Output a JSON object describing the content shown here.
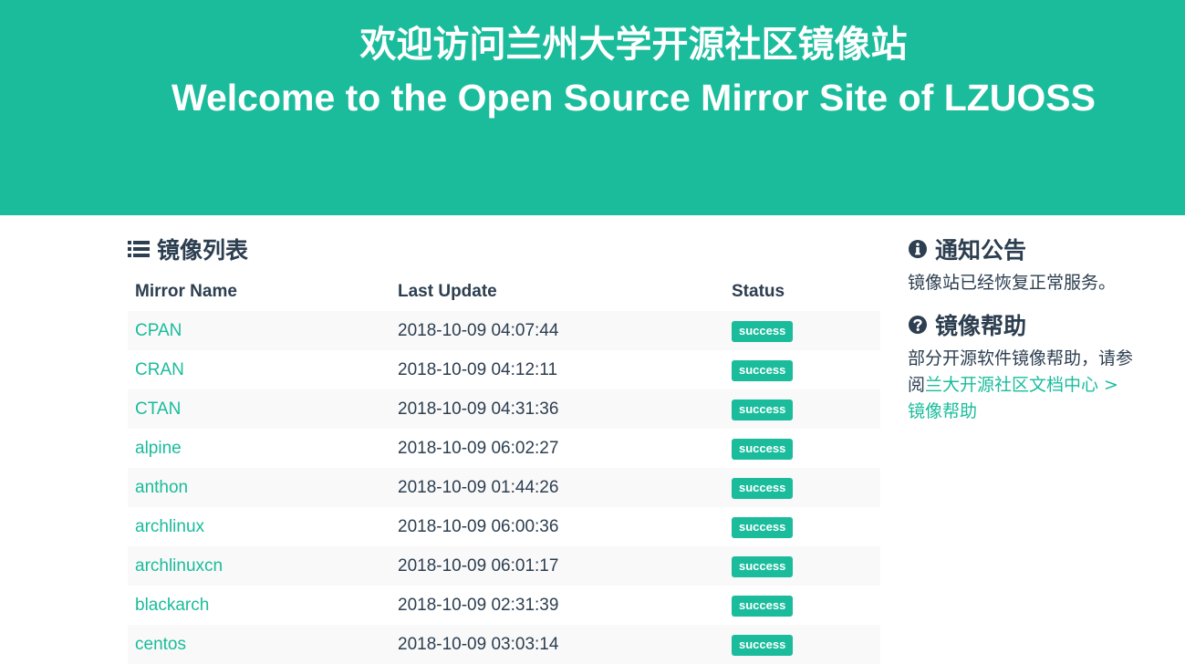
{
  "hero": {
    "title_cn": "欢迎访问兰州大学开源社区镜像站",
    "title_en": "Welcome to the Open Source Mirror Site of LZUOSS"
  },
  "mirror_list": {
    "heading": "镜像列表",
    "icon": "list-icon",
    "columns": {
      "name": "Mirror Name",
      "last_update": "Last Update",
      "status": "Status"
    },
    "rows": [
      {
        "name": "CPAN",
        "last_update": "2018-10-09 04:07:44",
        "status": "success"
      },
      {
        "name": "CRAN",
        "last_update": "2018-10-09 04:12:11",
        "status": "success"
      },
      {
        "name": "CTAN",
        "last_update": "2018-10-09 04:31:36",
        "status": "success"
      },
      {
        "name": "alpine",
        "last_update": "2018-10-09 06:02:27",
        "status": "success"
      },
      {
        "name": "anthon",
        "last_update": "2018-10-09 01:44:26",
        "status": "success"
      },
      {
        "name": "archlinux",
        "last_update": "2018-10-09 06:00:36",
        "status": "success"
      },
      {
        "name": "archlinuxcn",
        "last_update": "2018-10-09 06:01:17",
        "status": "success"
      },
      {
        "name": "blackarch",
        "last_update": "2018-10-09 02:31:39",
        "status": "success"
      },
      {
        "name": "centos",
        "last_update": "2018-10-09 03:03:14",
        "status": "success"
      }
    ]
  },
  "notice": {
    "heading": "通知公告",
    "icon": "info-circle-icon",
    "text": "镜像站已经恢复正常服务。"
  },
  "help": {
    "heading": "镜像帮助",
    "icon": "question-circle-icon",
    "text_prefix": "部分开源软件镜像帮助，请参阅",
    "link_text": "兰大开源社区文档中心 > 镜像帮助"
  },
  "colors": {
    "brand": "#1abc9c",
    "text": "#2c3e50"
  }
}
